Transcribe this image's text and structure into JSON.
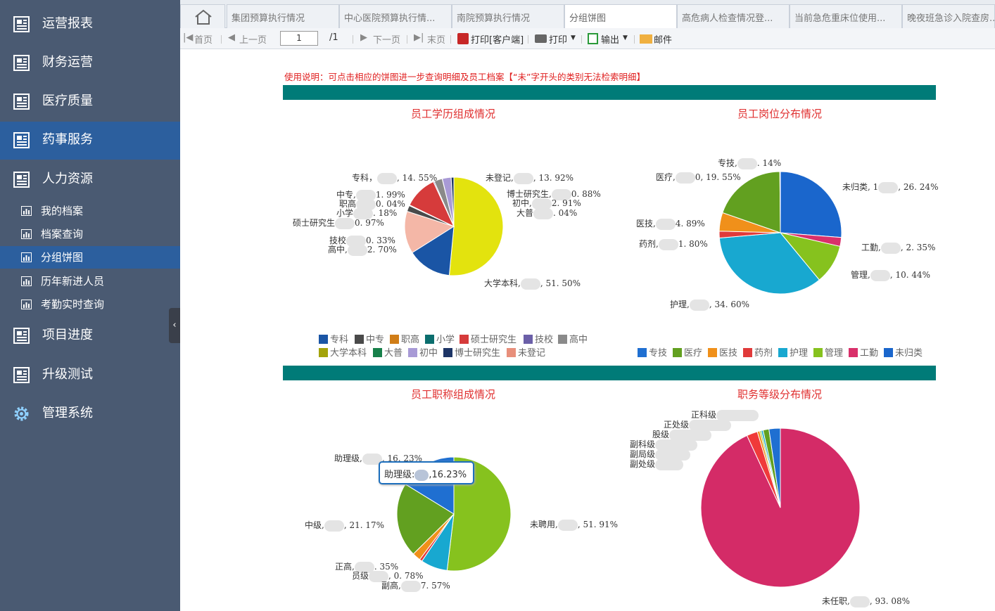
{
  "sidebar": {
    "items": [
      {
        "label": "运营报表"
      },
      {
        "label": "财务运营"
      },
      {
        "label": "医疗质量"
      },
      {
        "label": "药事服务"
      },
      {
        "label": "人力资源"
      },
      {
        "label": "项目进度"
      },
      {
        "label": "升级测试"
      },
      {
        "label": "管理系统"
      }
    ],
    "sub_items": [
      {
        "label": "我的档案"
      },
      {
        "label": "档案查询"
      },
      {
        "label": "分组饼图"
      },
      {
        "label": "历年新进人员"
      },
      {
        "label": "考勤实时查询"
      }
    ],
    "collapse_glyph": "‹"
  },
  "tabs": [
    {
      "label": "集团预算执行情况"
    },
    {
      "label": "中心医院预算执行情..."
    },
    {
      "label": "南院预算执行情况"
    },
    {
      "label": "分组饼图"
    },
    {
      "label": "高危病人检查情况登..."
    },
    {
      "label": "当前急危重床位使用..."
    },
    {
      "label": "晚夜班急诊入院查房..."
    }
  ],
  "toolbar": {
    "first": "首页",
    "prev": "上一页",
    "page_value": "1",
    "page_total": "/1",
    "next": "下一页",
    "last": "末页",
    "print_client": "打印[客户端]",
    "print": "打印",
    "export": "输出",
    "mail": "邮件"
  },
  "notice": "使用说明：可点击相应的饼图进一步查询明细及员工档案【“未”字开头的类别无法检索明细】",
  "charts": {
    "education": {
      "title": "员工学历组成情况",
      "labels": [
        "专科，",
        ", 14. 55%",
        "未登记,",
        ", 13. 92%",
        "中专,",
        "1. 99%",
        "博士研究生,",
        "0. 88%",
        "职高",
        "0. 04%",
        "初中,",
        "2. 91%",
        "小学",
        ". 18%",
        "大普",
        ". 04%",
        "硕士研究生",
        "0. 97%",
        "技校",
        "0. 33%",
        "高中,",
        "2. 70%",
        "大学本科,",
        ", 51. 50%"
      ],
      "legend": [
        "专科",
        "中专",
        "职高",
        "小学",
        "硕士研究生",
        "技校",
        "高中",
        "大学本科",
        "大普",
        "初中",
        "博士研究生",
        "未登记"
      ],
      "legend_colors": [
        "#1a55a5",
        "#4a4a4a",
        "#d07d17",
        "#0b6e6e",
        "#d63b3b",
        "#6b5fa8",
        "#8a8a8a",
        "#a3a30b",
        "#17804a",
        "#a89ad6",
        "#1d3566",
        "#e88f7b"
      ]
    },
    "position": {
      "title": "员工岗位分布情况",
      "labels": [
        "专技,",
        ". 14%",
        "医疗,",
        "0, 19. 55%",
        "未归类, 1",
        ", 26. 24%",
        "医技,",
        "4. 89%",
        "药剂,",
        "1. 80%",
        "工勤,",
        ", 2. 35%",
        "管理,",
        ", 10. 44%",
        "护理,",
        ", 34. 60%"
      ],
      "legend": [
        "专技",
        "医疗",
        "医技",
        "药剂",
        "护理",
        "管理",
        "工勤",
        "未归类"
      ],
      "legend_colors": [
        "#1f6fd1",
        "#62a020",
        "#f0901a",
        "#e03a3a",
        "#18a8d0",
        "#86c21e",
        "#d9306a",
        "#1a66cc"
      ]
    },
    "title_rank": {
      "title": "员工职称组成情况",
      "labels": [
        "助理级,",
        ", 16. 23%",
        "中级,",
        ", 21. 17%",
        "未聘用,",
        ", 51. 91%",
        "正高,",
        ". 35%",
        "员级",
        ", 0. 78%",
        "副高,",
        "7. 57%"
      ],
      "tooltip_label": "助理级:",
      "tooltip_value": ",16.23%"
    },
    "duty_level": {
      "title": "职务等级分布情况",
      "labels": [
        "正科级",
        "正处级",
        "股级",
        "副科级",
        "副局级",
        "副处级",
        "未任职,",
        ", 93. 08%"
      ]
    }
  },
  "chart_data": [
    {
      "type": "pie",
      "title": "员工学历组成情况",
      "categories": [
        "大学本科",
        "专科",
        "未登记",
        "中专",
        "职高",
        "小学",
        "硕士研究生",
        "技校",
        "高中",
        "大普",
        "初中",
        "博士研究生"
      ],
      "values": [
        51.5,
        14.55,
        13.92,
        1.99,
        0.04,
        0.18,
        10.97,
        0.33,
        2.7,
        0.04,
        2.91,
        0.88
      ],
      "colors": [
        "#e3e30e",
        "#1a55a5",
        "#f4b7a7",
        "#4a4a4a",
        "#d07d17",
        "#0b6e6e",
        "#d63b3b",
        "#6b5fa8",
        "#8a8a8a",
        "#17804a",
        "#a89ad6",
        "#1d3566"
      ],
      "legend": "bottom"
    },
    {
      "type": "pie",
      "title": "员工岗位分布情况",
      "categories": [
        "未归类",
        "工勤",
        "管理",
        "护理",
        "药剂",
        "医技",
        "医疗",
        "专技"
      ],
      "values": [
        26.24,
        2.35,
        10.44,
        34.6,
        1.8,
        4.89,
        19.55,
        0.14
      ],
      "colors": [
        "#1a66cc",
        "#d9306a",
        "#86c21e",
        "#18a8d0",
        "#e03a3a",
        "#f0901a",
        "#62a020",
        "#1f6fd1"
      ],
      "legend": "bottom"
    },
    {
      "type": "pie",
      "title": "员工职称组成情况",
      "categories": [
        "未聘用",
        "副高",
        "员级",
        "正高",
        "中级",
        "助理级"
      ],
      "values": [
        51.91,
        7.57,
        0.78,
        2.35,
        21.17,
        16.23
      ],
      "colors": [
        "#86c21e",
        "#18a8d0",
        "#e03a3a",
        "#f0901a",
        "#62a020",
        "#1f6fd1"
      ]
    },
    {
      "type": "pie",
      "title": "职务等级分布情况",
      "categories": [
        "未任职",
        "副处级",
        "副局级",
        "副科级",
        "股级",
        "正处级",
        "正科级"
      ],
      "values": [
        93.08,
        2.2,
        0.5,
        0.3,
        0.4,
        1.2,
        2.3
      ],
      "colors": [
        "#d42b67",
        "#f03a3a",
        "#f0901a",
        "#86c21e",
        "#18a8d0",
        "#62a020",
        "#1f6fd1"
      ]
    }
  ]
}
